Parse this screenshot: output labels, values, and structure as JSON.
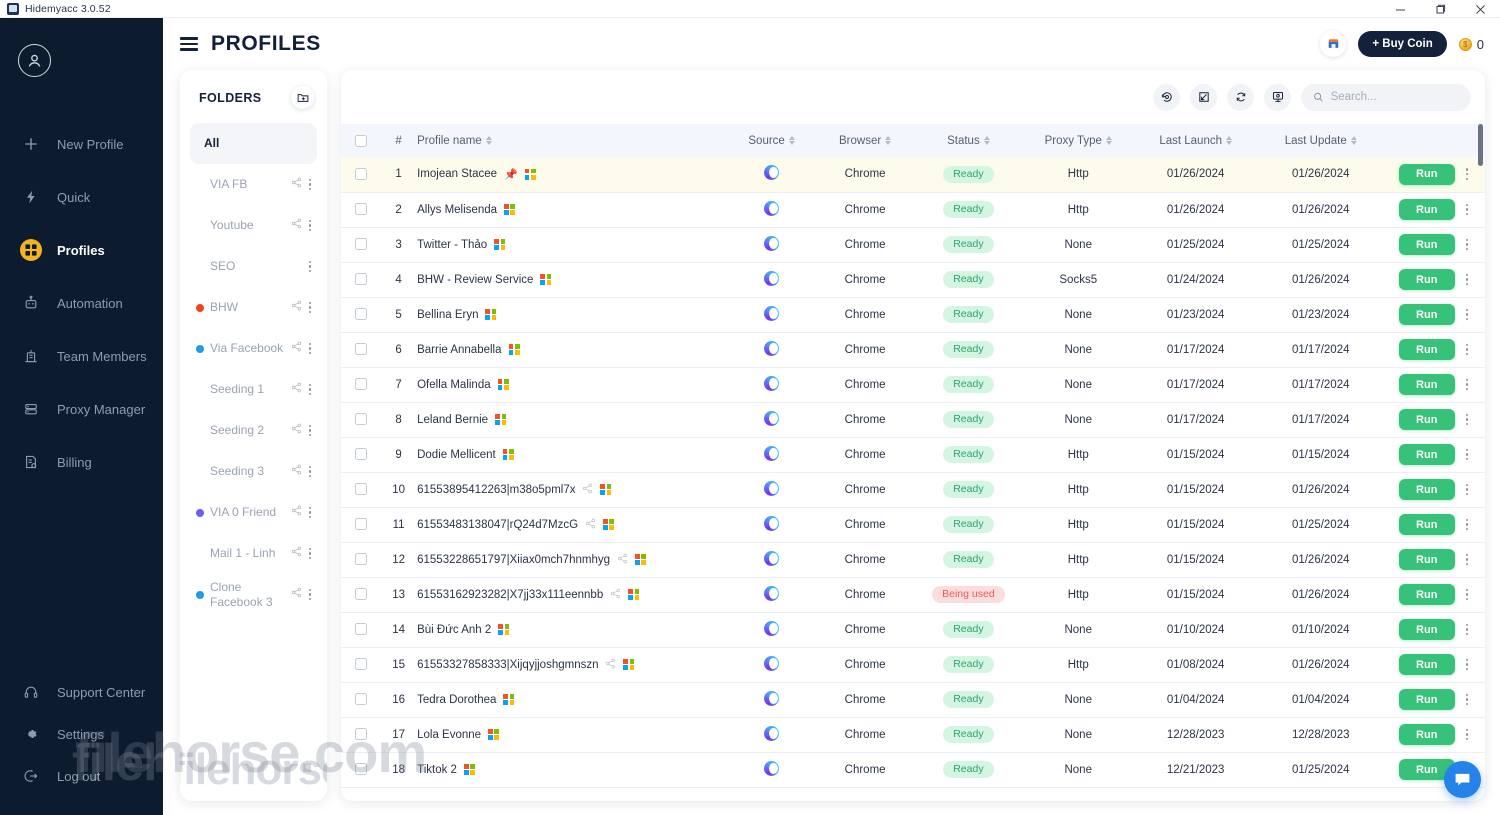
{
  "window": {
    "title": "Hidemyacc 3.0.52",
    "controls": {
      "minimize": "–",
      "maximize": "❐",
      "close": "✕"
    }
  },
  "header": {
    "title": "PROFILES",
    "menu_icon": "hamburger-icon",
    "store_icon": "store-icon",
    "buy_coin_label": "+ Buy Coin",
    "coin_balance": "0",
    "coin_symbol": "$"
  },
  "sidebar": {
    "avatar_icon": "user-avatar-icon",
    "items": [
      {
        "label": "New Profile",
        "icon": "plus-icon",
        "active": false
      },
      {
        "label": "Quick",
        "icon": "lightning-icon",
        "active": false
      },
      {
        "label": "Profiles",
        "icon": "grid-icon",
        "active": true
      },
      {
        "label": "Automation",
        "icon": "robot-icon",
        "active": false
      },
      {
        "label": "Team Members",
        "icon": "team-icon",
        "active": false
      },
      {
        "label": "Proxy Manager",
        "icon": "server-icon",
        "active": false
      },
      {
        "label": "Billing",
        "icon": "billing-icon",
        "active": false
      }
    ],
    "bottom_items": [
      {
        "label": "Support Center",
        "icon": "headset-icon"
      },
      {
        "label": "Settings",
        "icon": "gear-icon"
      },
      {
        "label": "Log out",
        "icon": "logout-icon"
      }
    ],
    "watermark": "filehorse"
  },
  "folders": {
    "title": "FOLDERS",
    "add_icon": "add-folder-icon",
    "watermark": "filehorse.com",
    "items": [
      {
        "label": "All",
        "color": "",
        "active": true,
        "share": false,
        "more": false
      },
      {
        "label": "VIA FB",
        "color": "",
        "active": false,
        "share": true,
        "more": true
      },
      {
        "label": "Youtube",
        "color": "",
        "active": false,
        "share": true,
        "more": true
      },
      {
        "label": "SEO",
        "color": "",
        "active": false,
        "share": false,
        "more": true
      },
      {
        "label": "BHW",
        "color": "#f4431c",
        "active": false,
        "share": true,
        "more": true
      },
      {
        "label": "Via Facebook",
        "color": "#1d9bf0",
        "active": false,
        "share": true,
        "more": true
      },
      {
        "label": "Seeding 1",
        "color": "",
        "active": false,
        "share": true,
        "more": true
      },
      {
        "label": "Seeding 2",
        "color": "",
        "active": false,
        "share": true,
        "more": true
      },
      {
        "label": "Seeding 3",
        "color": "",
        "active": false,
        "share": true,
        "more": true
      },
      {
        "label": "VIA 0 Friend",
        "color": "#6b5cf6",
        "active": false,
        "share": true,
        "more": true
      },
      {
        "label": "Mail 1 - Linh",
        "color": "",
        "active": false,
        "share": true,
        "more": true
      },
      {
        "label": "Clone Facebook 3",
        "color": "#1d9bf0",
        "active": false,
        "share": true,
        "more": true
      }
    ]
  },
  "toolbar": {
    "icons": [
      {
        "name": "history-restore-icon"
      },
      {
        "name": "import-icon"
      },
      {
        "name": "sync-icon"
      },
      {
        "name": "remote-settings-icon"
      }
    ],
    "search_placeholder": "Search...",
    "search_value": "",
    "search_icon": "search-icon"
  },
  "table": {
    "columns": [
      {
        "key": "checkbox",
        "label": ""
      },
      {
        "key": "index",
        "label": "#"
      },
      {
        "key": "name",
        "label": "Profile name",
        "sortable": true
      },
      {
        "key": "source",
        "label": "Source",
        "sortable": true
      },
      {
        "key": "browser",
        "label": "Browser",
        "sortable": true
      },
      {
        "key": "status",
        "label": "Status",
        "sortable": true
      },
      {
        "key": "proxy",
        "label": "Proxy Type",
        "sortable": true
      },
      {
        "key": "last_launch",
        "label": "Last Launch",
        "sortable": true
      },
      {
        "key": "last_update",
        "label": "Last Update",
        "sortable": true
      },
      {
        "key": "action",
        "label": ""
      }
    ],
    "run_label": "Run",
    "rows": [
      {
        "index": "1",
        "name": "Imojean Stacee",
        "pinned": true,
        "shared": false,
        "os": "windows",
        "source": "hidemyacc-icon",
        "browser": "Chrome",
        "status": "Ready",
        "status_type": "ready",
        "proxy": "Http",
        "last_launch": "01/26/2024",
        "last_update": "01/26/2024",
        "highlight": true
      },
      {
        "index": "2",
        "name": "Allys Melisenda",
        "pinned": false,
        "shared": false,
        "os": "windows",
        "source": "hidemyacc-icon",
        "browser": "Chrome",
        "status": "Ready",
        "status_type": "ready",
        "proxy": "Http",
        "last_launch": "01/26/2024",
        "last_update": "01/26/2024",
        "highlight": false
      },
      {
        "index": "3",
        "name": "Twitter - Thảo",
        "pinned": false,
        "shared": false,
        "os": "windows",
        "source": "hidemyacc-icon",
        "browser": "Chrome",
        "status": "Ready",
        "status_type": "ready",
        "proxy": "None",
        "last_launch": "01/25/2024",
        "last_update": "01/25/2024",
        "highlight": false
      },
      {
        "index": "4",
        "name": "BHW - Review Service",
        "pinned": false,
        "shared": false,
        "os": "windows",
        "source": "hidemyacc-icon",
        "browser": "Chrome",
        "status": "Ready",
        "status_type": "ready",
        "proxy": "Socks5",
        "last_launch": "01/24/2024",
        "last_update": "01/26/2024",
        "highlight": false
      },
      {
        "index": "5",
        "name": "Bellina Eryn",
        "pinned": false,
        "shared": false,
        "os": "windows",
        "source": "hidemyacc-icon",
        "browser": "Chrome",
        "status": "Ready",
        "status_type": "ready",
        "proxy": "None",
        "last_launch": "01/23/2024",
        "last_update": "01/23/2024",
        "highlight": false
      },
      {
        "index": "6",
        "name": "Barrie Annabella",
        "pinned": false,
        "shared": false,
        "os": "windows",
        "source": "hidemyacc-icon",
        "browser": "Chrome",
        "status": "Ready",
        "status_type": "ready",
        "proxy": "None",
        "last_launch": "01/17/2024",
        "last_update": "01/17/2024",
        "highlight": false
      },
      {
        "index": "7",
        "name": "Ofella Malinda",
        "pinned": false,
        "shared": false,
        "os": "windows",
        "source": "hidemyacc-icon",
        "browser": "Chrome",
        "status": "Ready",
        "status_type": "ready",
        "proxy": "None",
        "last_launch": "01/17/2024",
        "last_update": "01/17/2024",
        "highlight": false
      },
      {
        "index": "8",
        "name": "Leland Bernie",
        "pinned": false,
        "shared": false,
        "os": "windows",
        "source": "hidemyacc-icon",
        "browser": "Chrome",
        "status": "Ready",
        "status_type": "ready",
        "proxy": "None",
        "last_launch": "01/17/2024",
        "last_update": "01/17/2024",
        "highlight": false
      },
      {
        "index": "9",
        "name": "Dodie Mellicent",
        "pinned": false,
        "shared": false,
        "os": "windows",
        "source": "hidemyacc-icon",
        "browser": "Chrome",
        "status": "Ready",
        "status_type": "ready",
        "proxy": "Http",
        "last_launch": "01/15/2024",
        "last_update": "01/15/2024",
        "highlight": false
      },
      {
        "index": "10",
        "name": "61553895412263|m38o5pml7x",
        "pinned": false,
        "shared": true,
        "os": "windows",
        "source": "hidemyacc-icon",
        "browser": "Chrome",
        "status": "Ready",
        "status_type": "ready",
        "proxy": "Http",
        "last_launch": "01/15/2024",
        "last_update": "01/26/2024",
        "highlight": false
      },
      {
        "index": "11",
        "name": "61553483138047|rQ24d7MzcG",
        "pinned": false,
        "shared": true,
        "os": "windows",
        "source": "hidemyacc-icon",
        "browser": "Chrome",
        "status": "Ready",
        "status_type": "ready",
        "proxy": "Http",
        "last_launch": "01/15/2024",
        "last_update": "01/25/2024",
        "highlight": false
      },
      {
        "index": "12",
        "name": "61553228651797|Xiiax0mch7hnmhyg",
        "pinned": false,
        "shared": true,
        "os": "windows",
        "source": "hidemyacc-icon",
        "browser": "Chrome",
        "status": "Ready",
        "status_type": "ready",
        "proxy": "Http",
        "last_launch": "01/15/2024",
        "last_update": "01/26/2024",
        "highlight": false
      },
      {
        "index": "13",
        "name": "61553162923282|X7jj33x111eennbb",
        "pinned": false,
        "shared": true,
        "os": "windows",
        "source": "hidemyacc-icon",
        "browser": "Chrome",
        "status": "Being used",
        "status_type": "used",
        "proxy": "Http",
        "last_launch": "01/15/2024",
        "last_update": "01/26/2024",
        "highlight": false
      },
      {
        "index": "14",
        "name": "Bùi Đức Anh 2",
        "pinned": false,
        "shared": false,
        "os": "windows",
        "source": "hidemyacc-icon",
        "browser": "Chrome",
        "status": "Ready",
        "status_type": "ready",
        "proxy": "None",
        "last_launch": "01/10/2024",
        "last_update": "01/10/2024",
        "highlight": false
      },
      {
        "index": "15",
        "name": "61553327858333|Xijqyjjoshgmnszn",
        "pinned": false,
        "shared": true,
        "os": "windows",
        "source": "hidemyacc-icon",
        "browser": "Chrome",
        "status": "Ready",
        "status_type": "ready",
        "proxy": "Http",
        "last_launch": "01/08/2024",
        "last_update": "01/26/2024",
        "highlight": false
      },
      {
        "index": "16",
        "name": "Tedra Dorothea",
        "pinned": false,
        "shared": false,
        "os": "windows",
        "source": "hidemyacc-icon",
        "browser": "Chrome",
        "status": "Ready",
        "status_type": "ready",
        "proxy": "None",
        "last_launch": "01/04/2024",
        "last_update": "01/04/2024",
        "highlight": false
      },
      {
        "index": "17",
        "name": "Lola Evonne",
        "pinned": false,
        "shared": false,
        "os": "windows",
        "source": "hidemyacc-icon",
        "browser": "Chrome",
        "status": "Ready",
        "status_type": "ready",
        "proxy": "None",
        "last_launch": "12/28/2023",
        "last_update": "12/28/2023",
        "highlight": false
      },
      {
        "index": "18",
        "name": "Tiktok 2",
        "pinned": false,
        "shared": false,
        "os": "windows",
        "source": "hidemyacc-icon",
        "browser": "Chrome",
        "status": "Ready",
        "status_type": "ready",
        "proxy": "None",
        "last_launch": "12/21/2023",
        "last_update": "01/25/2024",
        "highlight": false
      }
    ]
  },
  "chat": {
    "icon": "chat-bubble-icon"
  },
  "colors": {
    "sidebar_bg": "#0d1b2f",
    "accent_yellow": "#f5b324",
    "run_green": "#36c279",
    "badge_ready_bg": "#d5f5e3",
    "badge_used_bg": "#fddcdc",
    "header_row_bg": "#f3f7fd",
    "highlight_row_bg": "#fdfbec",
    "chat_blue": "#2482e8"
  }
}
